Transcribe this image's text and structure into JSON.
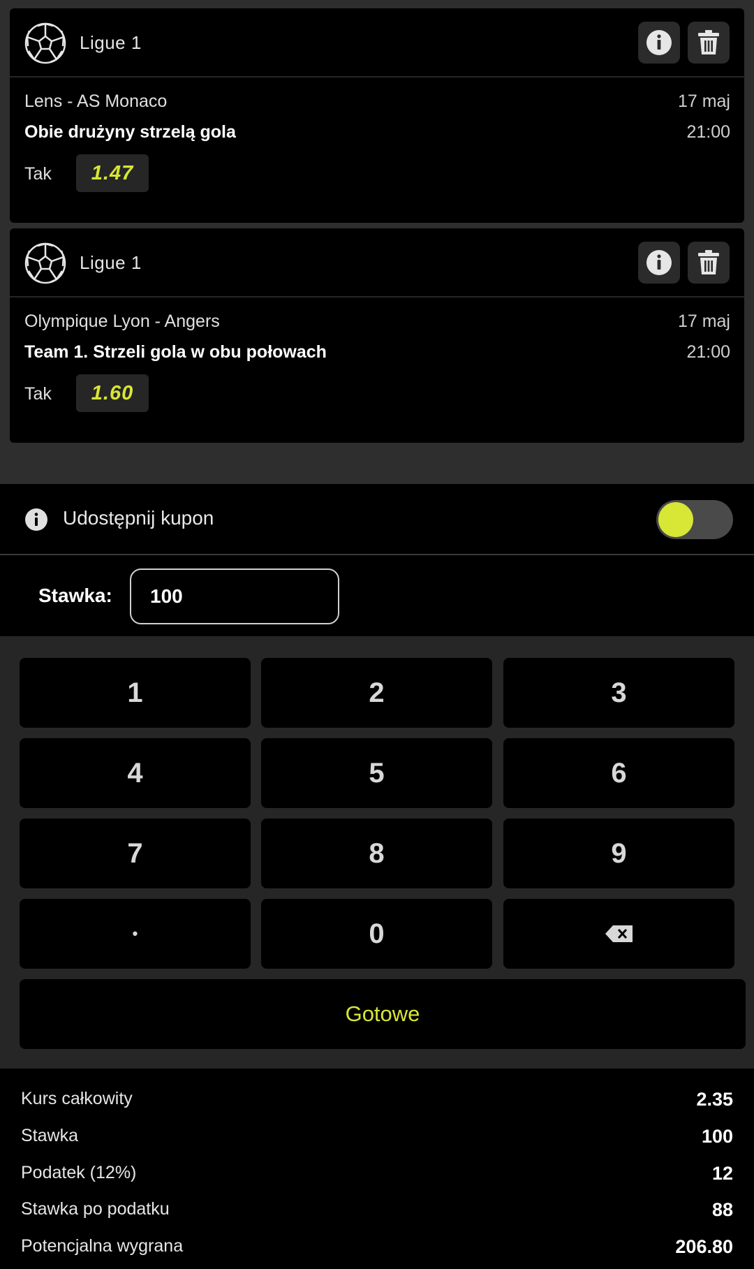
{
  "bets": [
    {
      "league": "Ligue 1",
      "match": "Lens - AS Monaco",
      "market": "Obie drużyny strzelą gola",
      "date": "17 maj",
      "time": "21:00",
      "pick": "Tak",
      "odd": "1.47"
    },
    {
      "league": "Ligue 1",
      "match": "Olympique Lyon - Angers",
      "market": "Team 1. Strzeli gola w obu połowach",
      "date": "17 maj",
      "time": "21:00",
      "pick": "Tak",
      "odd": "1.60"
    }
  ],
  "share": {
    "label": "Udostępnij kupon",
    "toggle_on": true
  },
  "stake": {
    "label": "Stawka:",
    "value": "100"
  },
  "keypad": {
    "keys": [
      "1",
      "2",
      "3",
      "4",
      "5",
      "6",
      "7",
      "8",
      "9",
      "•",
      "0"
    ],
    "backspace_icon": "backspace-icon",
    "done_label": "Gotowe"
  },
  "summary": [
    {
      "label": "Kurs całkowity",
      "value": "2.35"
    },
    {
      "label": "Stawka",
      "value": "100"
    },
    {
      "label": "Podatek (12%)",
      "value": "12"
    },
    {
      "label": "Stawka po podatku",
      "value": "88"
    },
    {
      "label": "Potencjalna wygrana",
      "value": "206.80"
    }
  ],
  "colors": {
    "accent": "#d8e635",
    "background": "#000000",
    "panel": "#262626"
  }
}
